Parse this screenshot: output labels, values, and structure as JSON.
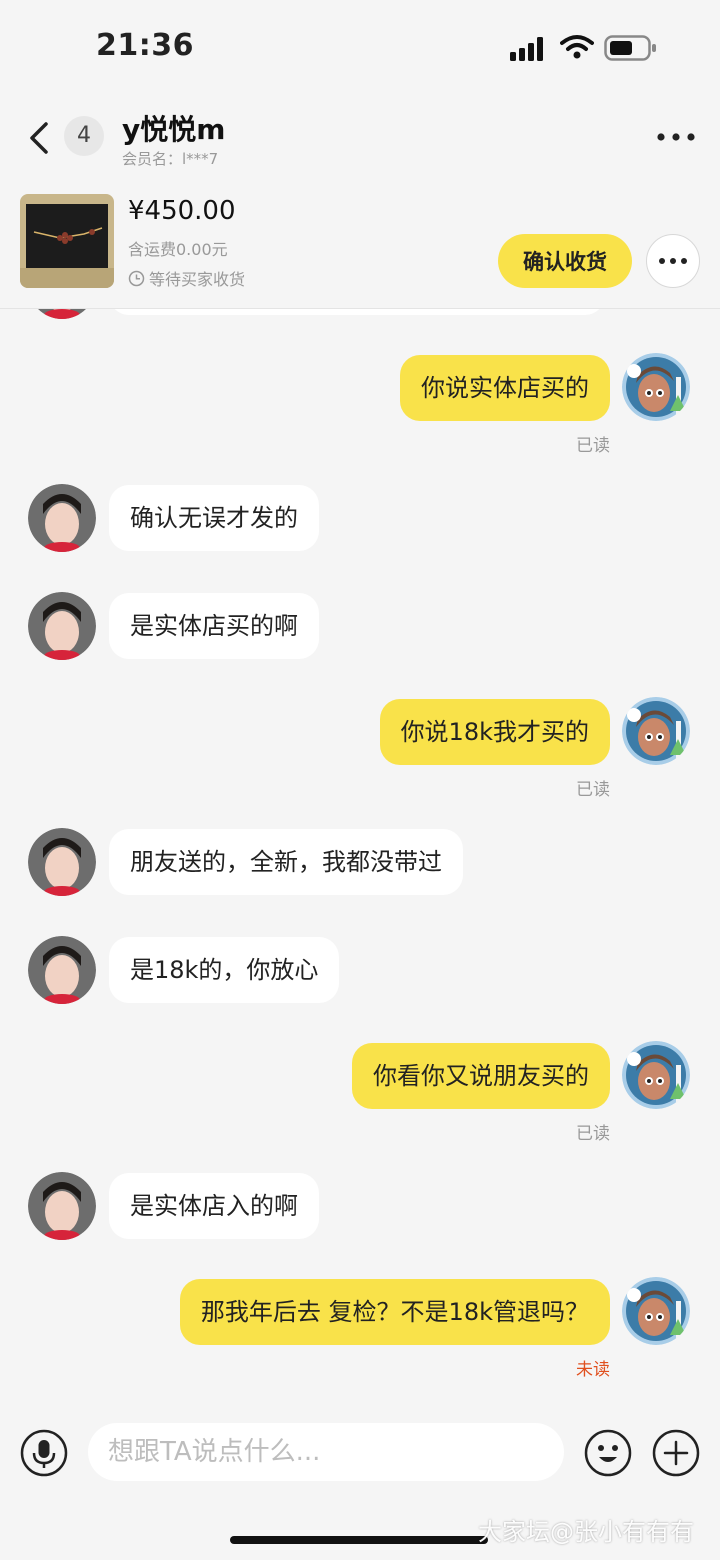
{
  "status": {
    "time": "21:36"
  },
  "header": {
    "unread_count": "4",
    "nickname": "y悦悦m",
    "member_label": "会员名：l***7"
  },
  "order": {
    "price": "¥450.00",
    "shipping": "含运费0.00元",
    "status": "等待买家收货",
    "confirm_label": "确认收货"
  },
  "messages": [
    {
      "side": "out",
      "text": "你说实体店买的",
      "read": "已读"
    },
    {
      "side": "in",
      "text": "确认无误才发的"
    },
    {
      "side": "in",
      "text": "是实体店买的啊"
    },
    {
      "side": "out",
      "text": "你说18k我才买的",
      "read": "已读"
    },
    {
      "side": "in",
      "text": "朋友送的，全新，我都没带过"
    },
    {
      "side": "in",
      "text": "是18k的，你放心"
    },
    {
      "side": "out",
      "text": "你看你又说朋友买的",
      "read": "已读"
    },
    {
      "side": "in",
      "text": "是实体店入的啊"
    },
    {
      "side": "out",
      "text": "那我年后去 复检？不是18k管退吗？",
      "read": "未读"
    }
  ],
  "composer": {
    "placeholder": "想跟TA说点什么..."
  },
  "watermark": "大家坛@张小有有有",
  "colors": {
    "accent": "#f9e24a",
    "unread": "#e0501f",
    "muted": "#999999"
  }
}
